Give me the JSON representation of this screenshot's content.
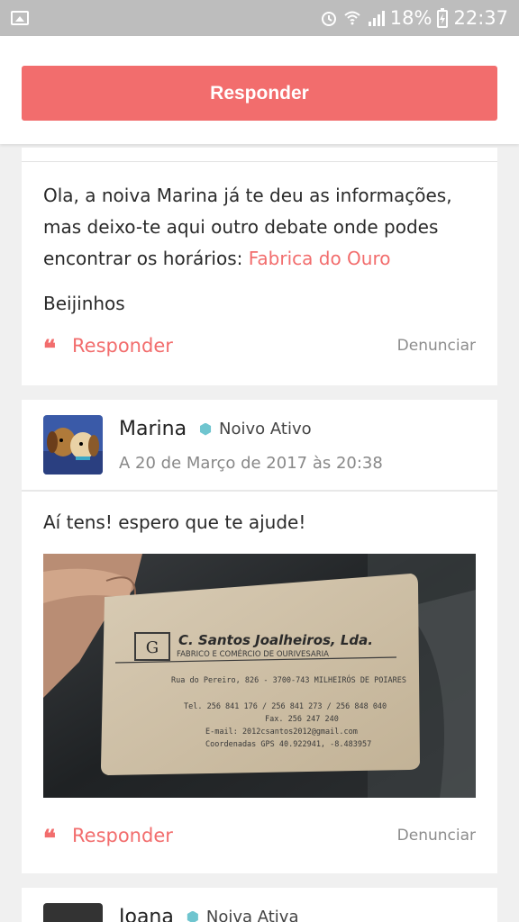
{
  "status_bar": {
    "battery": "18%",
    "time": "22:37"
  },
  "top_action": {
    "responder_label": "Responder"
  },
  "reply_card": {
    "text_before_link": "Ola, a noiva Marina já te deu as informações, mas deixo-te aqui outro debate onde podes encontrar os horários: ",
    "link_text": "Fabrica do Ouro",
    "closing": "Beijinhos",
    "reply_label": "Responder",
    "report_label": "Denunciar"
  },
  "post": {
    "author": "Marina",
    "badge": "Noivo Ativo",
    "date": "A 20 de Março de 2017 às 20:38",
    "message": "Aí tens! espero que te ajude!",
    "business_card": {
      "company": "C. Santos Joalheiros, Lda.",
      "subtitle": "FABRICO E COMÉRCIO DE OURIVESARIA",
      "address": "Rua do Pereiro, 826 - 3700-743 MILHEIRÓS DE POIARES",
      "phones": "Tel. 256 841 176 / 256 841 273 / 256 848 040",
      "fax": "Fax. 256 247 240",
      "email": "E-mail: 2012csantos2012@gmail.com",
      "gps": "Coordenadas GPS 40.922941, -8.483957"
    },
    "reply_label": "Responder",
    "report_label": "Denunciar"
  },
  "next_post": {
    "author": "Joana",
    "badge": "Noiva Ativa"
  }
}
